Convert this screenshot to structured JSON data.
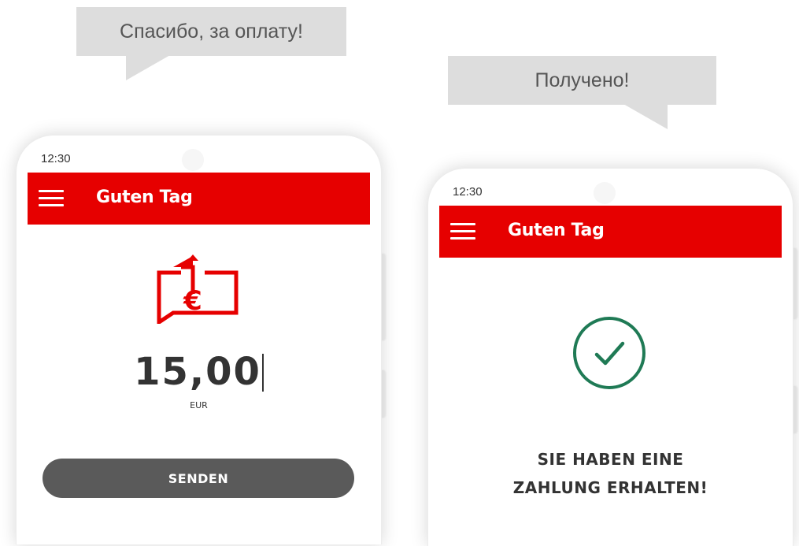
{
  "bubbles": {
    "left": "Спасибо, за оплату!",
    "right": "Получено!"
  },
  "phone_left": {
    "status_time": "12:30",
    "app_title": "Guten Tag",
    "amount": "15,00",
    "currency": "EUR",
    "send_button": "SENDEN",
    "icon": "send-euro-icon"
  },
  "phone_right": {
    "status_time": "12:30",
    "app_title": "Guten Tag",
    "message_line1": "SIE HABEN EINE",
    "message_line2": "ZAHLUNG ERHALTEN!",
    "icon": "check-circle-icon"
  },
  "colors": {
    "brand_red": "#e60000",
    "button_gray": "#5a5a5a",
    "check_green": "#1f7a55",
    "bubble_gray": "#dddddd"
  }
}
